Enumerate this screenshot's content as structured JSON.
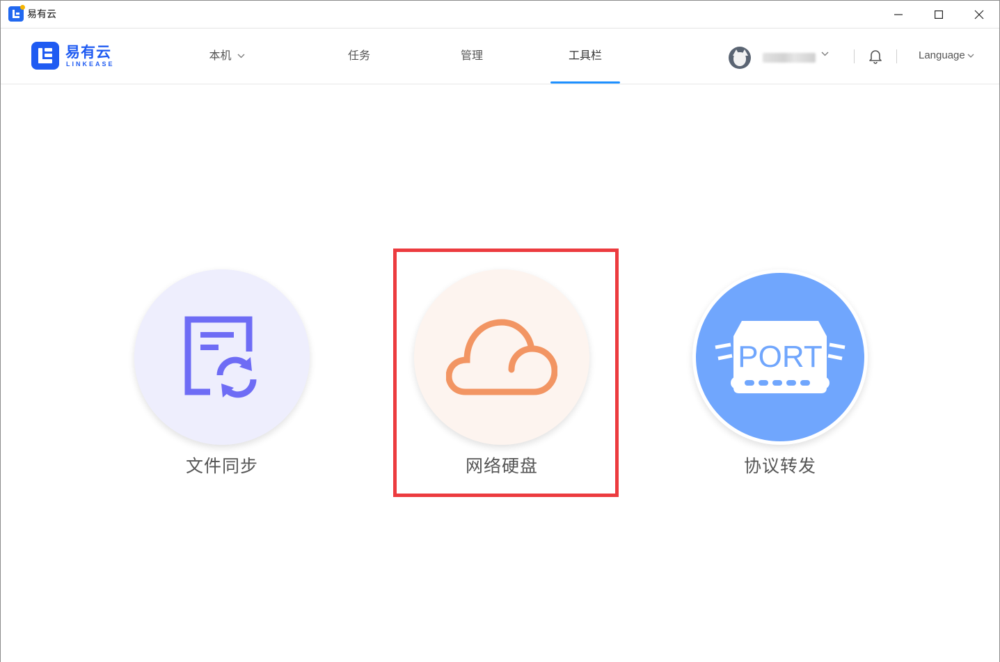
{
  "window": {
    "title": "易有云",
    "controls": {
      "minimize": "minimize-icon",
      "maximize": "maximize-icon",
      "close": "close-icon"
    }
  },
  "header": {
    "logo": {
      "name": "易有云",
      "sub": "LINKEASE"
    },
    "nav": [
      {
        "label": "本机",
        "has_dropdown": true,
        "active": false
      },
      {
        "label": "任务",
        "active": false
      },
      {
        "label": "管理",
        "active": false
      },
      {
        "label": "工具栏",
        "active": true
      }
    ],
    "language_label": "Language"
  },
  "tools": [
    {
      "label": "文件同步",
      "icon": "file-sync-icon",
      "color": "#6e6cf5",
      "background": "#eeeefd"
    },
    {
      "label": "网络硬盘",
      "icon": "cloud-icon",
      "color": "#f29563",
      "background": "#fdf4ef",
      "highlighted": true
    },
    {
      "label": "协议转发",
      "icon": "port-icon",
      "color": "#ffffff",
      "background": "#70a6fd",
      "icon_text": "PORT"
    }
  ],
  "colors": {
    "accent": "#1e90ff",
    "brand": "#1f5bf2",
    "highlight_box": "#ec3b3f"
  }
}
